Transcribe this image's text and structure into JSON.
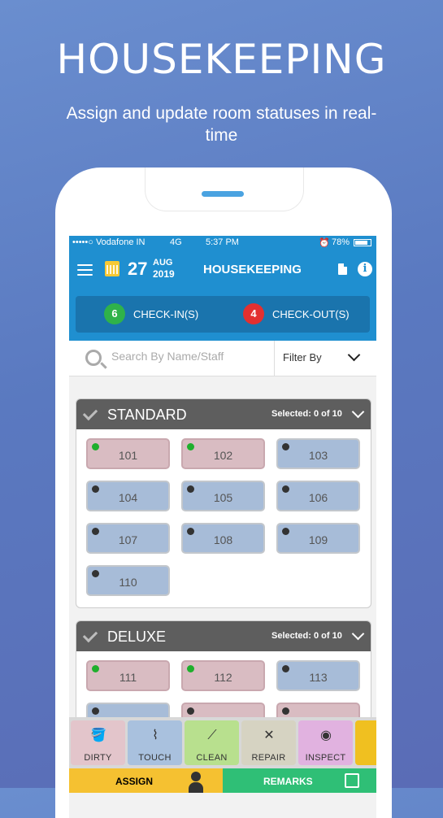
{
  "hero": {
    "title": "HOUSEKEEPING",
    "subtitle": "Assign and update room statuses in real-time"
  },
  "status_bar": {
    "carrier": "•••••○ Vodafone IN",
    "network": "4G",
    "time": "5:37 PM",
    "battery": "78%"
  },
  "app_bar": {
    "day": "27",
    "month": "AUG",
    "year": "2019",
    "title": "HOUSEKEEPING"
  },
  "check_bar": {
    "checkin": {
      "count": "6",
      "label": "CHECK-IN(S)",
      "color": "#2fb24a"
    },
    "checkout": {
      "count": "4",
      "label": "CHECK-OUT(S)",
      "color": "#e33030"
    }
  },
  "search": {
    "placeholder": "Search By Name/Staff",
    "filter_label": "Filter By"
  },
  "sections": [
    {
      "name": "STANDARD",
      "selected": "Selected: 0 of 10",
      "rooms": [
        {
          "num": "101",
          "status": "dirty",
          "dot": "green"
        },
        {
          "num": "102",
          "status": "dirty",
          "dot": "green"
        },
        {
          "num": "103",
          "status": "clean",
          "dot": "black"
        },
        {
          "num": "104",
          "status": "clean",
          "dot": "black"
        },
        {
          "num": "105",
          "status": "clean",
          "dot": "black"
        },
        {
          "num": "106",
          "status": "clean",
          "dot": "black"
        },
        {
          "num": "107",
          "status": "clean",
          "dot": "black"
        },
        {
          "num": "108",
          "status": "clean",
          "dot": "black"
        },
        {
          "num": "109",
          "status": "clean",
          "dot": "black"
        },
        {
          "num": "110",
          "status": "clean",
          "dot": "black"
        }
      ]
    },
    {
      "name": "DELUXE",
      "selected": "Selected: 0 of 10",
      "rooms": [
        {
          "num": "111",
          "status": "dirty",
          "dot": "green"
        },
        {
          "num": "112",
          "status": "dirty",
          "dot": "green"
        },
        {
          "num": "113",
          "status": "clean",
          "dot": "black"
        },
        {
          "num": "",
          "status": "clean",
          "dot": "black"
        },
        {
          "num": "",
          "status": "dirty",
          "dot": "black"
        },
        {
          "num": "",
          "status": "dirty",
          "dot": "black"
        }
      ]
    }
  ],
  "actions": [
    {
      "label": "DIRTY",
      "icon": "bucket-icon",
      "color": "#e3c5cb"
    },
    {
      "label": "TOUCH",
      "icon": "brush-icon",
      "color": "#a9c1de"
    },
    {
      "label": "CLEAN",
      "icon": "broom-icon",
      "color": "#b8e08e"
    },
    {
      "label": "REPAIR",
      "icon": "wrench-icon",
      "color": "#d6d3c2"
    },
    {
      "label": "INSPECT",
      "icon": "eye-icon",
      "color": "#e1b2e0"
    },
    {
      "label": "",
      "icon": "more-icon",
      "color": "#f0c020"
    }
  ],
  "bottom": {
    "assign": "ASSIGN",
    "remarks": "REMARKS"
  },
  "colors": {
    "dirty": "#d9bcc2",
    "clean": "#a7bcd8",
    "dirty_border": "#c9a8af",
    "clean_border": "#c3c7cc",
    "dot_green": "#1faf2c",
    "dot_black": "#333333"
  }
}
